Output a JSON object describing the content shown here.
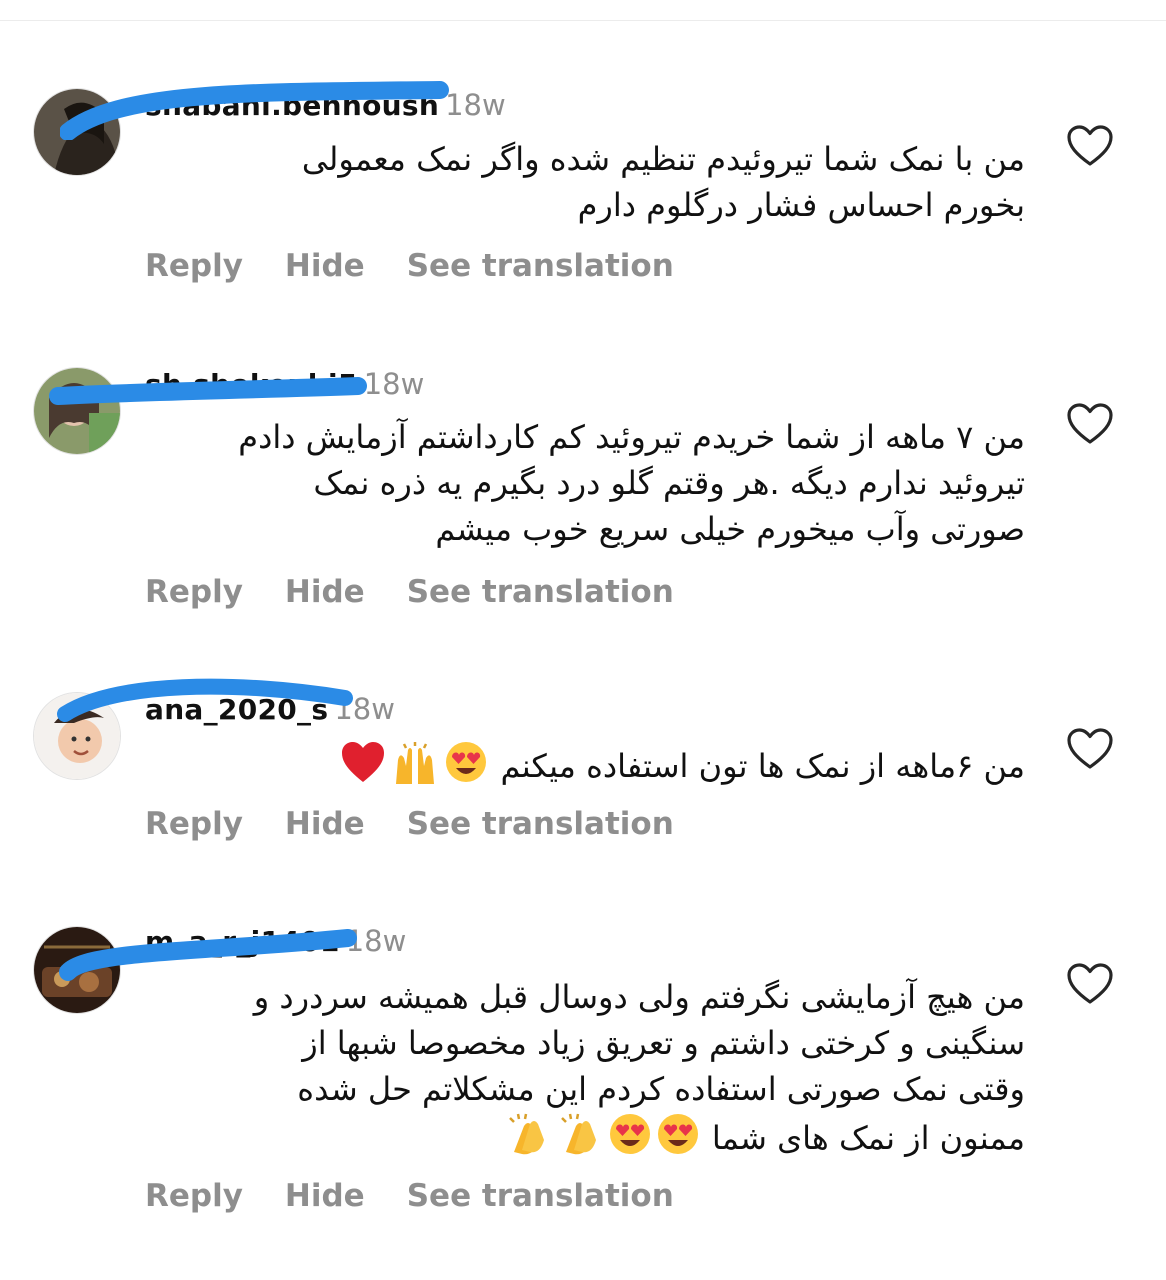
{
  "comments": [
    {
      "username": "shabani.behnoush",
      "time": "18w",
      "lines": [
        "من با نمک شما تیروئیدم تنظیم شده واگر نمک معمولی",
        "بخورم احساس فشار درگلوم دارم"
      ],
      "actions": {
        "reply": "Reply",
        "hide": "Hide",
        "translate": "See translation"
      }
    },
    {
      "username": "sh.shokouhi5",
      "time": "18w",
      "lines": [
        "من ۷ ماهه از شما خریدم تیروئید کم کارداشتم آزمایش دادم",
        "تیروئید ندارم دیگه .هر وقتم گلو درد بگیرم یه ذره نمک",
        "صورتی وآب میخورم خیلی سریع خوب میشم"
      ],
      "actions": {
        "reply": "Reply",
        "hide": "Hide",
        "translate": "See translation"
      }
    },
    {
      "username": "ana_2020_s",
      "time": "18w",
      "lines": [
        "من ۶ماهه از نمک ها تون استفاده میکنم"
      ],
      "emojis": [
        "heart-eyes-emoji",
        "raised-hands-emoji",
        "red-heart-emoji"
      ],
      "actions": {
        "reply": "Reply",
        "hide": "Hide",
        "translate": "See translation"
      }
    },
    {
      "username": "m_a_r_j1401",
      "time": "18w",
      "lines": [
        "من هیچ آزمایشی نگرفتم ولی دوسال قبل همیشه سردرد و",
        "سنگینی و کرختی داشتم  و تعریق زیاد مخصوصا شبها از",
        "وقتی نمک صورتی استفاده کردم این مشکلاتم حل شده",
        "ممنون از نمک های شما"
      ],
      "emojis": [
        "heart-eyes-emoji",
        "heart-eyes-emoji",
        "clapping-hands-emoji",
        "clapping-hands-emoji"
      ],
      "actions": {
        "reply": "Reply",
        "hide": "Hide",
        "translate": "See translation"
      }
    }
  ],
  "colors": {
    "redaction": "#2b8be6",
    "muted": "#8e8e8e",
    "text": "#111111",
    "heart_outline": "#262626"
  }
}
